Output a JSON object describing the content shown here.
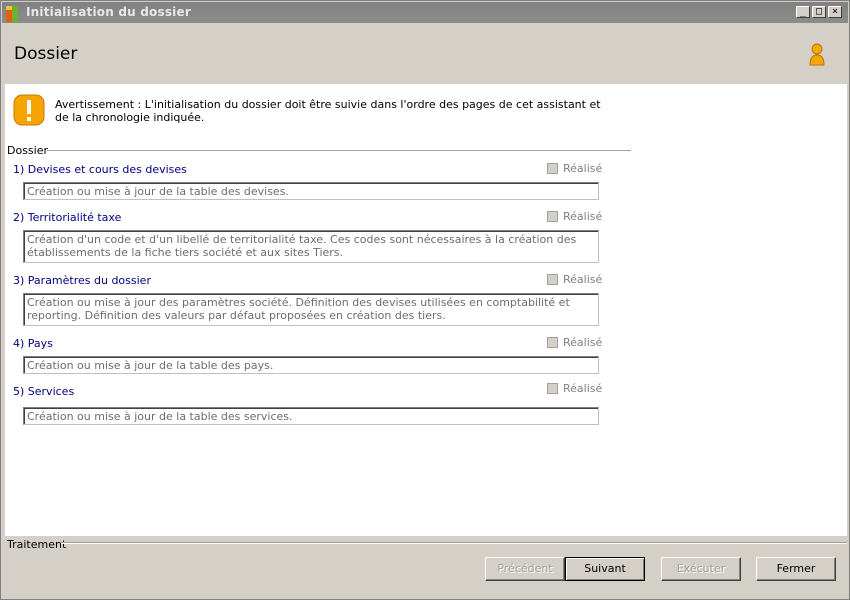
{
  "window": {
    "title": "Initialisation du dossier"
  },
  "header": {
    "title": "Dossier"
  },
  "warning": {
    "text": "Avertissement : L'initialisation du dossier doit être suivie dans l'ordre des pages de cet assistant et de la chronologie indiquée."
  },
  "group": {
    "label": "Dossier"
  },
  "steps": [
    {
      "title": "1) Devises et cours des devises",
      "done_label": "Réalisé",
      "done": false,
      "description": "Création ou mise à jour de la table des devises."
    },
    {
      "title": "2) Territorialité taxe",
      "done_label": "Réalisé",
      "done": false,
      "description": "Création d'un code et d'un libellé de territorialité taxe. Ces codes sont nécessaires à la création des établissements de la fiche tiers société et aux sites Tiers."
    },
    {
      "title": "3) Paramètres du dossier",
      "done_label": "Réalisé",
      "done": false,
      "description": "Création ou mise à jour des paramètres société. Définition des devises utilisées en comptabilité et reporting. Définition des valeurs par défaut proposées en création des tiers."
    },
    {
      "title": "4) Pays",
      "done_label": "Réalisé",
      "done": false,
      "description": "Création ou mise à jour de la table des pays."
    },
    {
      "title": "5) Services",
      "done_label": "Réalisé",
      "done": false,
      "description": "Création ou mise à jour de la table des services."
    }
  ],
  "footer": {
    "label": "Traitement",
    "buttons": {
      "previous": "Précédent",
      "next": "Suivant",
      "execute": "Exécuter",
      "close": "Fermer"
    }
  },
  "colors": {
    "step_title": "#000080",
    "titlebar": "#808080",
    "warning": "#f7a400"
  },
  "icons": [
    "app-icon",
    "minimize-icon",
    "maximize-icon",
    "close-icon",
    "user-icon",
    "warning-icon"
  ]
}
